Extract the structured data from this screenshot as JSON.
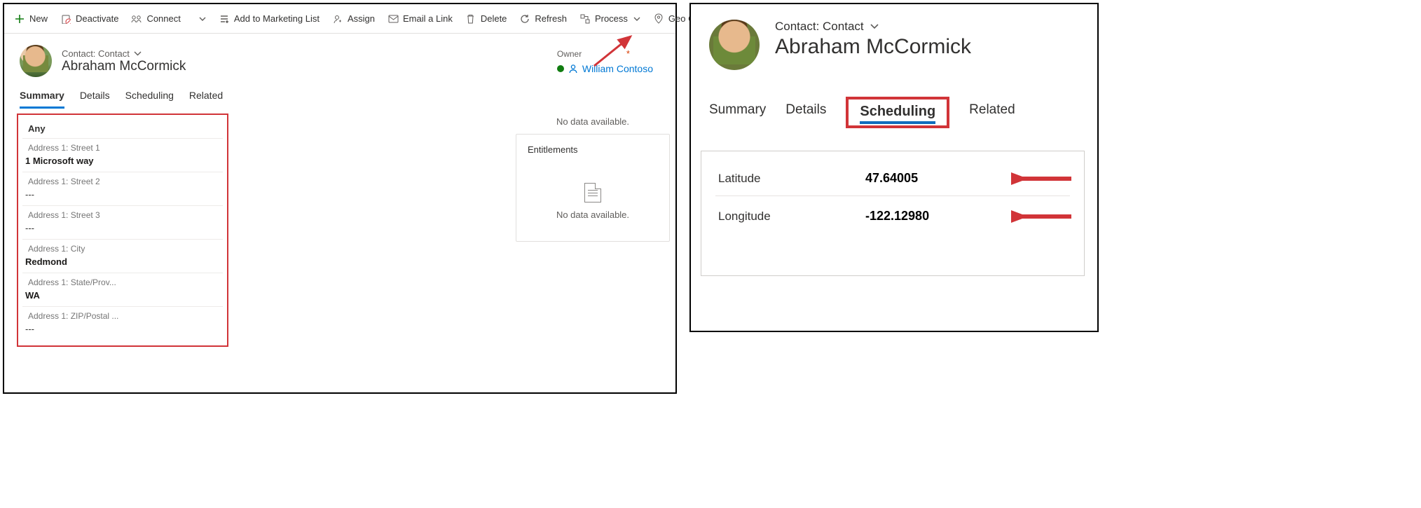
{
  "left": {
    "toolbar": {
      "new": "New",
      "deactivate": "Deactivate",
      "connect": "Connect",
      "addToMarketing": "Add to Marketing List",
      "assign": "Assign",
      "emailLink": "Email a Link",
      "delete": "Delete",
      "refresh": "Refresh",
      "process": "Process",
      "geoCode": "Geo Code"
    },
    "breadcrumb": "Contact: Contact",
    "title": "Abraham McCormick",
    "owner": {
      "label": "Owner",
      "name": "William Contoso"
    },
    "tabs": {
      "summary": "Summary",
      "details": "Details",
      "scheduling": "Scheduling",
      "related": "Related"
    },
    "address": {
      "any": "Any",
      "street1Label": "Address 1: Street 1",
      "street1": "1 Microsoft way",
      "street2Label": "Address 1: Street 2",
      "street2": "---",
      "street3Label": "Address 1: Street 3",
      "street3": "---",
      "cityLabel": "Address 1: City",
      "city": "Redmond",
      "stateLabel": "Address 1: State/Prov...",
      "state": "WA",
      "zipLabel": "Address 1: ZIP/Postal ...",
      "zip": "---"
    },
    "noDataTop": "No data available.",
    "entitlements": {
      "title": "Entitlements",
      "empty": "No data available."
    }
  },
  "right": {
    "breadcrumb": "Contact: Contact",
    "title": "Abraham McCormick",
    "tabs": {
      "summary": "Summary",
      "details": "Details",
      "scheduling": "Scheduling",
      "related": "Related"
    },
    "fields": {
      "latLabel": "Latitude",
      "latVal": "47.64005",
      "lonLabel": "Longitude",
      "lonVal": "-122.12980"
    }
  }
}
